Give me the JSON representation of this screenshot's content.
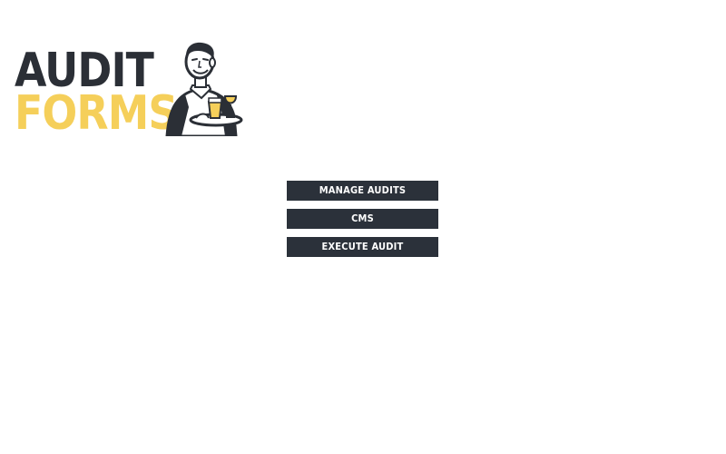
{
  "logo": {
    "line1": "AUDIT",
    "line2": "FORMS",
    "primary_color": "#2b2f36",
    "accent_color": "#f5cf5a",
    "mascot_icon": "waiter-with-tray-icon"
  },
  "menu": {
    "manage_audits_label": "MANAGE AUDITS",
    "cms_label": "CMS",
    "execute_audit_label": "EXECUTE AUDIT",
    "button_color": "#2b313a"
  }
}
